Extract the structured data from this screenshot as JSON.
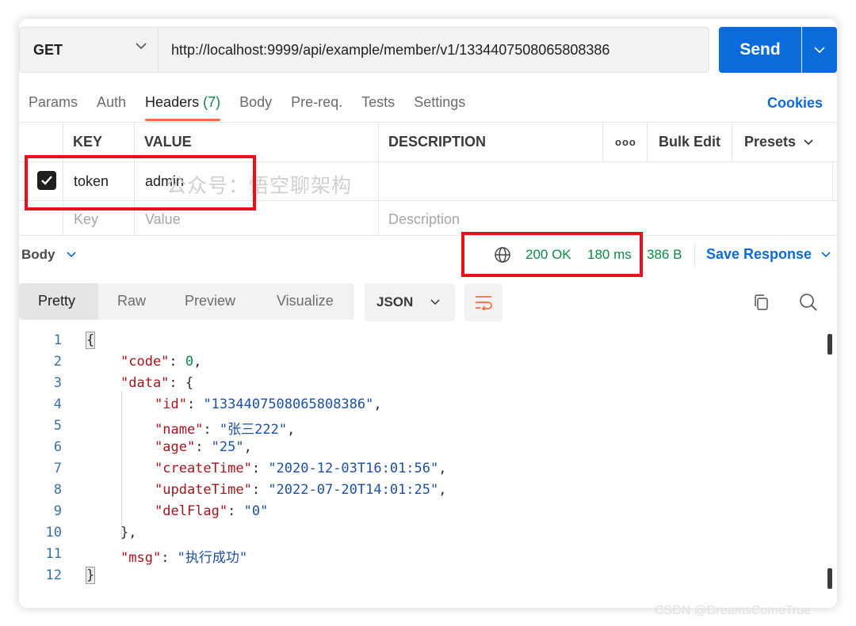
{
  "request": {
    "method": "GET",
    "url": "http://localhost:9999/api/example/member/v1/1334407508065808386",
    "send_label": "Send"
  },
  "tabs": [
    {
      "label": "Params"
    },
    {
      "label": "Auth"
    },
    {
      "label": "Headers",
      "count": "(7)"
    },
    {
      "label": "Body"
    },
    {
      "label": "Pre-req."
    },
    {
      "label": "Tests"
    },
    {
      "label": "Settings"
    }
  ],
  "cookies_label": "Cookies",
  "headers_table": {
    "columns": {
      "key": "KEY",
      "value": "VALUE",
      "description": "DESCRIPTION"
    },
    "more_label": "ooo",
    "bulk_edit_label": "Bulk Edit",
    "presets_label": "Presets",
    "rows": [
      {
        "checked": true,
        "key": "token",
        "value": "admin"
      }
    ],
    "placeholder": {
      "key": "Key",
      "value": "Value",
      "description": "Description"
    }
  },
  "watermark": "公众号：悟空聊架构",
  "response": {
    "body_label": "Body",
    "status": "200 OK",
    "time": "180 ms",
    "size": "386 B",
    "save_label": "Save Response"
  },
  "view_tabs": [
    "Pretty",
    "Raw",
    "Preview",
    "Visualize"
  ],
  "format_label": "JSON",
  "code": {
    "line_numbers": [
      "1",
      "2",
      "3",
      "4",
      "5",
      "6",
      "7",
      "8",
      "9",
      "10",
      "11",
      "12"
    ],
    "open_brace": "{",
    "close_brace": "}",
    "code_key": "\"code\"",
    "code_val": "0",
    "data_key": "\"data\"",
    "id_key": "\"id\"",
    "id_val": "\"1334407508065808386\"",
    "name_key": "\"name\"",
    "name_val": "\"张三222\"",
    "age_key": "\"age\"",
    "age_val": "\"25\"",
    "createTime_key": "\"createTime\"",
    "createTime_val": "\"2020-12-03T16:01:56\"",
    "updateTime_key": "\"updateTime\"",
    "updateTime_val": "\"2022-07-20T14:01:25\"",
    "delFlag_key": "\"delFlag\"",
    "delFlag_val": "\"0\"",
    "msg_key": "\"msg\"",
    "msg_val": "\"执行成功\""
  },
  "csdn": "CSDN @DreamsComeTrue"
}
